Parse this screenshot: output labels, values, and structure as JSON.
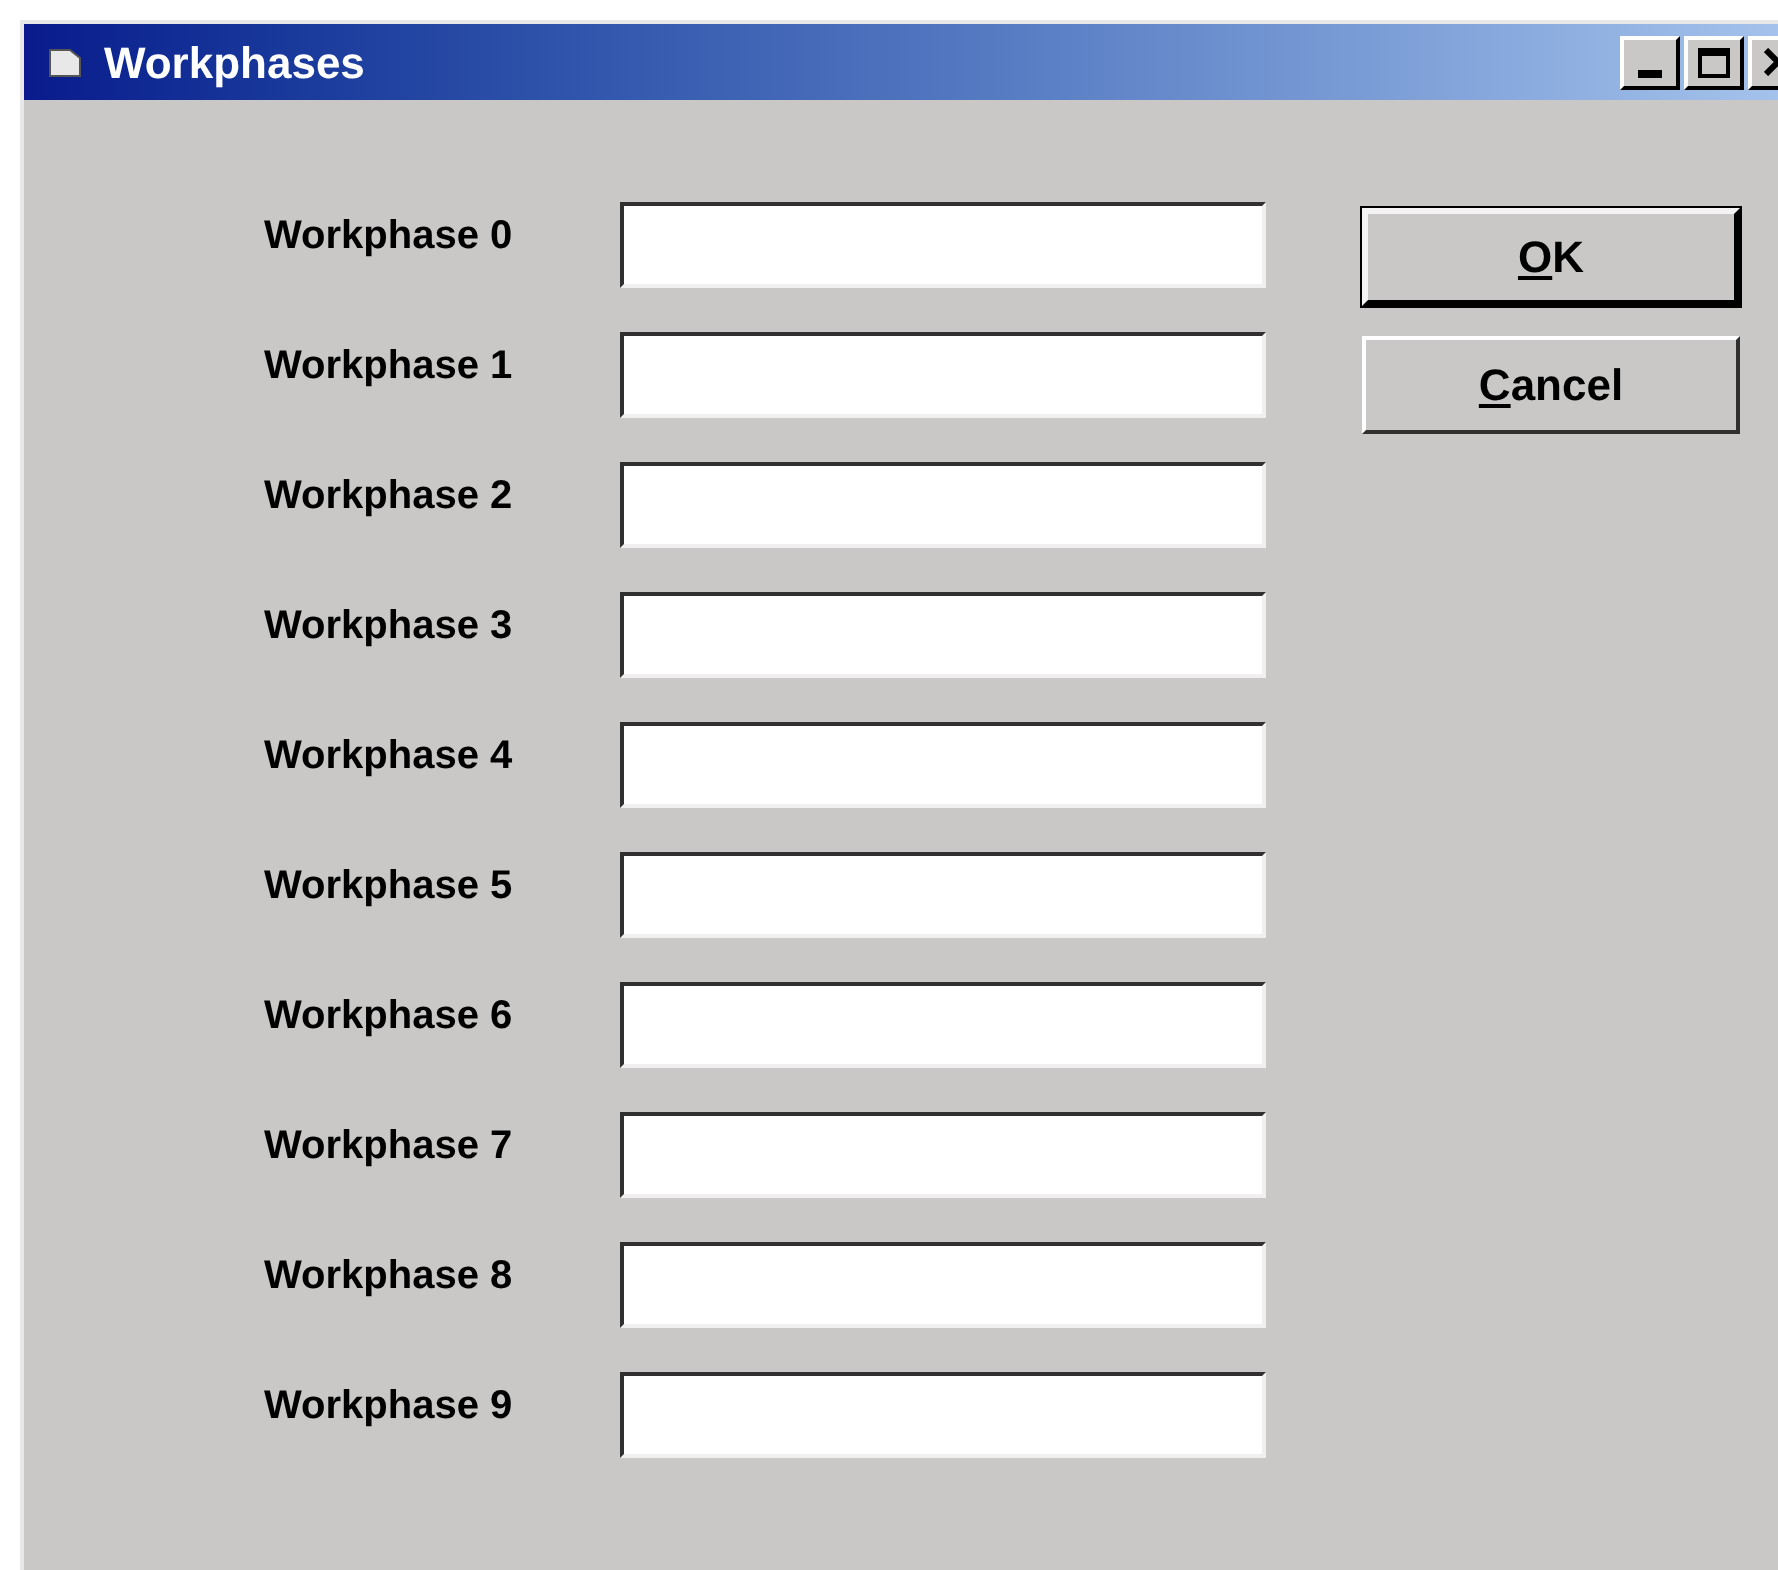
{
  "window": {
    "title": "Workphases"
  },
  "fields": [
    {
      "label": "Workphase 0"
    },
    {
      "label": "Workphase 1"
    },
    {
      "label": "Workphase 2"
    },
    {
      "label": "Workphase 3"
    },
    {
      "label": "Workphase 4"
    },
    {
      "label": "Workphase 5"
    },
    {
      "label": "Workphase 6"
    },
    {
      "label": "Workphase 7"
    },
    {
      "label": "Workphase 8"
    },
    {
      "label": "Workphase 9"
    }
  ],
  "buttons": [
    {
      "accelerator": "O",
      "rest": "K",
      "default": true
    },
    {
      "accelerator": "C",
      "rest": "ancel",
      "default": false
    }
  ]
}
